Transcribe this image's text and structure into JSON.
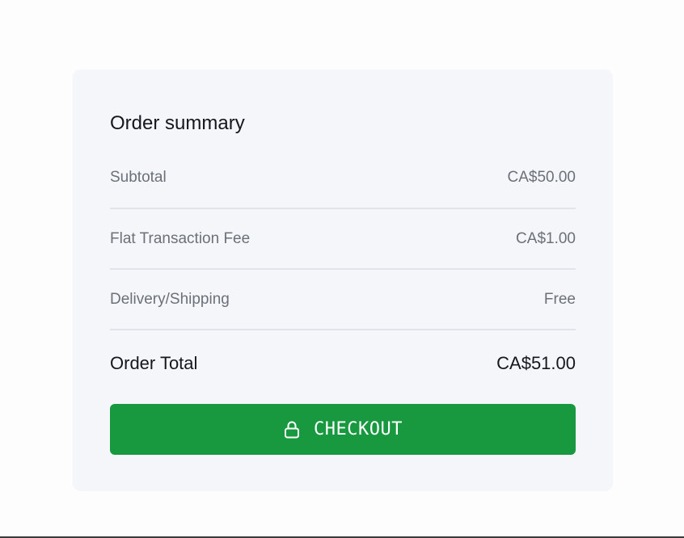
{
  "summary": {
    "title": "Order summary",
    "rows": [
      {
        "label": "Subtotal",
        "value": "CA$50.00"
      },
      {
        "label": "Flat Transaction Fee",
        "value": "CA$1.00"
      },
      {
        "label": "Delivery/Shipping",
        "value": "Free"
      }
    ],
    "total": {
      "label": "Order Total",
      "value": "CA$51.00"
    },
    "checkout": {
      "label": "CHECKOUT",
      "icon": "lock-icon"
    }
  },
  "colors": {
    "card_background": "#f5f6fa",
    "checkout_button": "#18983f",
    "divider": "#e1e4ea"
  }
}
